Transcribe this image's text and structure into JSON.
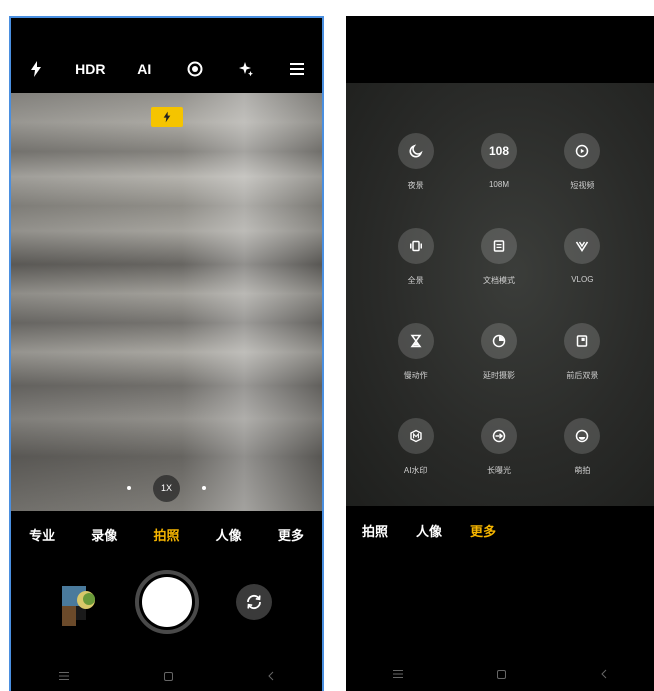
{
  "left_screen": {
    "top_bar": {
      "flash_icon": "flash-icon",
      "hdr": "HDR",
      "ai": "AI",
      "live_icon": "live-photo-icon",
      "beauty_icon": "sparkle-icon",
      "menu_icon": "menu-icon"
    },
    "flash_badge_icon": "flash-icon",
    "zoom": {
      "level": "1X"
    },
    "modes": [
      "专业",
      "录像",
      "拍照",
      "人像",
      "更多"
    ],
    "active_mode": "拍照",
    "nav": [
      "menu-icon",
      "home-icon",
      "back-icon"
    ]
  },
  "right_screen": {
    "more_modes": [
      {
        "label": "夜景",
        "icon": "moon-icon"
      },
      {
        "label": "108M",
        "icon": "108-text-icon",
        "icon_text": "108"
      },
      {
        "label": "短视频",
        "icon": "play-icon"
      },
      {
        "label": "全景",
        "icon": "panorama-icon"
      },
      {
        "label": "文档模式",
        "icon": "document-icon"
      },
      {
        "label": "VLOG",
        "icon": "vlog-icon"
      },
      {
        "label": "慢动作",
        "icon": "hourglass-icon"
      },
      {
        "label": "延时摄影",
        "icon": "timelapse-icon"
      },
      {
        "label": "前后双景",
        "icon": "dual-view-icon"
      },
      {
        "label": "AI水印",
        "icon": "watermark-icon"
      },
      {
        "label": "长曝光",
        "icon": "long-exposure-icon"
      },
      {
        "label": "萌拍",
        "icon": "cute-face-icon"
      }
    ],
    "modes": [
      "拍照",
      "人像",
      "更多"
    ],
    "active_mode": "更多"
  },
  "colors": {
    "accent": "#f5b500",
    "flash_badge": "#f5c400",
    "frame_border": "#4a8fe0"
  }
}
